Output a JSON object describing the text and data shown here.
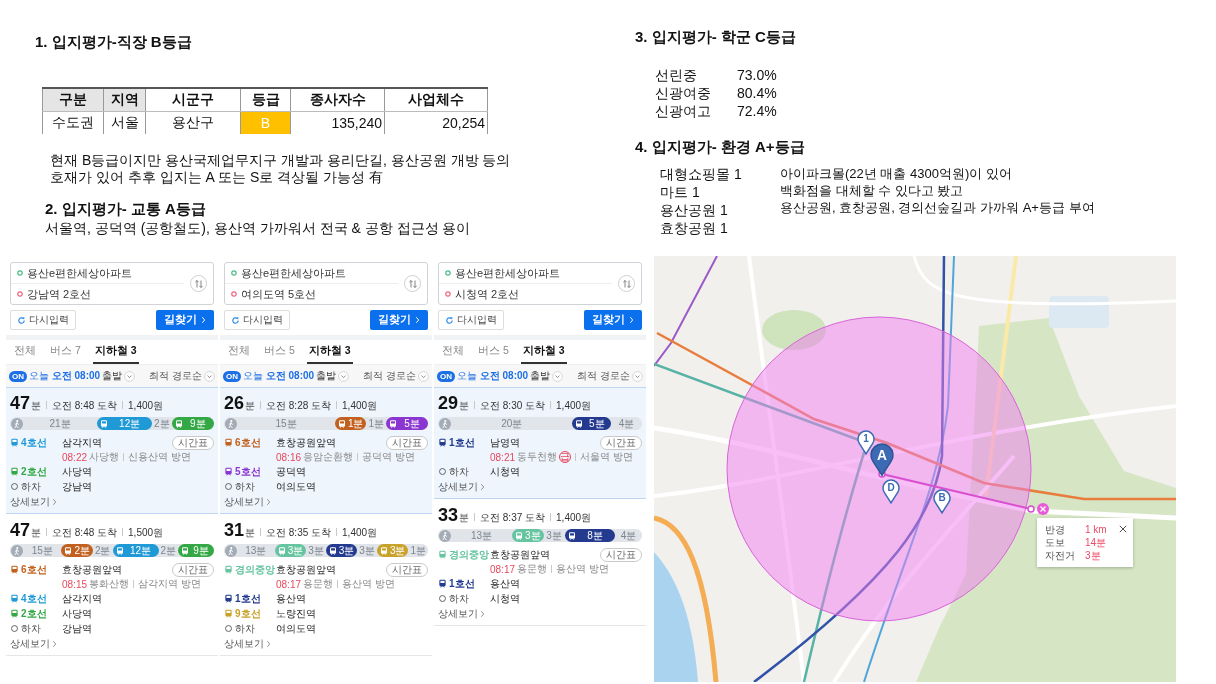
{
  "section1": {
    "heading": "1. 입지평가-직장 B등급",
    "table": {
      "columns": [
        {
          "label": "구분",
          "shaded": true
        },
        {
          "label": "지역",
          "shaded": true
        },
        {
          "label": "시군구",
          "shaded": false
        },
        {
          "label": "등급",
          "shaded": false
        },
        {
          "label": "종사자수",
          "shaded": false
        },
        {
          "label": "사업체수",
          "shaded": false
        }
      ],
      "rows": [
        {
          "cells": [
            {
              "text": "수도권",
              "kind": "text"
            },
            {
              "text": "서울",
              "kind": "text"
            },
            {
              "text": "용산구",
              "kind": "text"
            },
            {
              "text": "B",
              "kind": "grade",
              "color": "#ffc000"
            },
            {
              "text": "135,240",
              "kind": "number"
            },
            {
              "text": "20,254",
              "kind": "number"
            }
          ]
        }
      ]
    },
    "note": [
      "현재 B등급이지만 용산국제업무지구 개발과 용리단길, 용산공원 개방 등의",
      "호재가 있어 추후 입지는 A 또는 S로 격상될 가능성 有"
    ]
  },
  "section2": {
    "heading": "2. 입지평가- 교통 A등급",
    "text": "서울역, 공덕역 (공항철도), 용산역 가까워서 전국 & 공항 접근성 용이"
  },
  "route_panels": [
    {
      "origin": "용산e편한세상아파트",
      "destination": "강남역 2호선",
      "reset_button": "다시입력",
      "search_button": "길찾기",
      "tabs": [
        {
          "label": "전체",
          "selected": false
        },
        {
          "label": "버스 7",
          "selected": false
        },
        {
          "label": "지하철 3",
          "selected": true
        }
      ],
      "toggle": {
        "label": "ON",
        "on": true
      },
      "departure": "오늘 **오전 08:00**",
      "departure_suffix": "출발",
      "sort": "최적 경로순",
      "routes": [
        {
          "selected": true,
          "duration": "47",
          "unit": "분",
          "arrival": "오전 8:48 도착",
          "fare": "1,400원",
          "segments": [
            {
              "kind": "walk",
              "label": "21분"
            },
            {
              "kind": "ride",
              "label": "12분",
              "color": "#1f9ad6"
            },
            {
              "kind": "transfer",
              "label": "2분"
            },
            {
              "kind": "ride",
              "label": "9분",
              "color": "#33a845"
            }
          ],
          "steps": [
            {
              "kind": "board",
              "line": "4호선",
              "color": "#1f9ad6",
              "station": "삼각지역",
              "timetable": "시간표",
              "time": "08:22",
              "direction": "사당행",
              "towards": "신용산역 방면"
            },
            {
              "kind": "board",
              "line": "2호선",
              "color": "#33a845",
              "station": "사당역"
            },
            {
              "kind": "alight",
              "line": "하차",
              "station": "강남역"
            }
          ],
          "details": "상세보기"
        },
        {
          "selected": false,
          "duration": "47",
          "unit": "분",
          "arrival": "오전 8:48 도착",
          "fare": "1,500원",
          "segments": [
            {
              "kind": "walk",
              "label": "15분"
            },
            {
              "kind": "ride",
              "label": "2분",
              "color": "#c2611f"
            },
            {
              "kind": "transfer",
              "label": "2분"
            },
            {
              "kind": "ride",
              "label": "12분",
              "color": "#1f9ad6"
            },
            {
              "kind": "transfer",
              "label": "2분"
            },
            {
              "kind": "ride",
              "label": "9분",
              "color": "#33a845"
            }
          ],
          "steps": [
            {
              "kind": "board",
              "line": "6호선",
              "color": "#c2611f",
              "station": "효창공원앞역",
              "timetable": "시간표",
              "time": "08:15",
              "direction": "봉화산행",
              "towards": "삼각지역 방면"
            },
            {
              "kind": "board",
              "line": "4호선",
              "color": "#1f9ad6",
              "station": "삼각지역"
            },
            {
              "kind": "board",
              "line": "2호선",
              "color": "#33a845",
              "station": "사당역"
            },
            {
              "kind": "alight",
              "line": "하차",
              "station": "강남역"
            }
          ],
          "details": "상세보기"
        }
      ]
    },
    {
      "origin": "용산e편한세상아파트",
      "destination": "여의도역 5호선",
      "reset_button": "다시입력",
      "search_button": "길찾기",
      "tabs": [
        {
          "label": "전체",
          "selected": false
        },
        {
          "label": "버스 5",
          "selected": false
        },
        {
          "label": "지하철 3",
          "selected": true
        }
      ],
      "toggle": {
        "label": "ON",
        "on": true
      },
      "departure": "오늘 **오전 08:00**",
      "departure_suffix": "출발",
      "sort": "최적 경로순",
      "routes": [
        {
          "selected": true,
          "duration": "26",
          "unit": "분",
          "arrival": "오전 8:28 도착",
          "fare": "1,400원",
          "segments": [
            {
              "kind": "walk",
              "label": "15분"
            },
            {
              "kind": "ride",
              "label": "1분",
              "color": "#c2611f"
            },
            {
              "kind": "transfer",
              "label": "1분"
            },
            {
              "kind": "ride",
              "label": "5분",
              "color": "#8b36d1"
            }
          ],
          "steps": [
            {
              "kind": "board",
              "line": "6호선",
              "color": "#c2611f",
              "station": "효창공원앞역",
              "timetable": "시간표",
              "time": "08:16",
              "direction": "응암순환행",
              "towards": "공덕역 방면"
            },
            {
              "kind": "board",
              "line": "5호선",
              "color": "#8b36d1",
              "station": "공덕역"
            },
            {
              "kind": "alight",
              "line": "하차",
              "station": "여의도역"
            }
          ],
          "details": "상세보기"
        },
        {
          "selected": false,
          "duration": "31",
          "unit": "분",
          "arrival": "오전 8:35 도착",
          "fare": "1,400원",
          "segments": [
            {
              "kind": "walk",
              "label": "13분"
            },
            {
              "kind": "ride",
              "label": "3분",
              "color": "#66c4a0"
            },
            {
              "kind": "transfer",
              "label": "3분"
            },
            {
              "kind": "ride",
              "label": "3분",
              "color": "#233a8f"
            },
            {
              "kind": "transfer",
              "label": "3분"
            },
            {
              "kind": "ride",
              "label": "3분",
              "color": "#c9a22a"
            },
            {
              "kind": "transfer",
              "label": "1분"
            }
          ],
          "steps": [
            {
              "kind": "board",
              "line": "경의중앙",
              "color": "#66c4a0",
              "station": "효창공원앞역",
              "timetable": "시간표",
              "time": "08:17",
              "direction": "용문행",
              "towards": "용산역 방면"
            },
            {
              "kind": "board",
              "line": "1호선",
              "color": "#233a8f",
              "station": "용산역"
            },
            {
              "kind": "board",
              "line": "9호선",
              "color": "#c9a22a",
              "station": "노량진역"
            },
            {
              "kind": "alight",
              "line": "하차",
              "station": "여의도역"
            }
          ],
          "details": "상세보기"
        }
      ]
    },
    {
      "origin": "용산e편한세상아파트",
      "destination": "시청역 2호선",
      "reset_button": "다시입력",
      "search_button": "길찾기",
      "tabs": [
        {
          "label": "전체",
          "selected": false
        },
        {
          "label": "버스 5",
          "selected": false
        },
        {
          "label": "지하철 3",
          "selected": true
        }
      ],
      "toggle": {
        "label": "ON",
        "on": true
      },
      "departure": "오늘 **오전 08:00**",
      "departure_suffix": "출발",
      "sort": "최적 경로순",
      "routes": [
        {
          "selected": true,
          "duration": "29",
          "unit": "분",
          "arrival": "오전 8:30 도착",
          "fare": "1,400원",
          "segments": [
            {
              "kind": "walk",
              "label": "20분"
            },
            {
              "kind": "ride",
              "label": "5분",
              "color": "#233a8f"
            },
            {
              "kind": "transfer",
              "label": "4분"
            }
          ],
          "steps": [
            {
              "kind": "board",
              "line": "1호선",
              "color": "#233a8f",
              "station": "남영역",
              "timetable": "시간표",
              "time": "08:21",
              "direction": "동두천행",
              "badge": "급",
              "towards": "서울역 방면"
            },
            {
              "kind": "alight",
              "line": "하차",
              "station": "시청역"
            }
          ],
          "details": "상세보기"
        },
        {
          "selected": false,
          "duration": "33",
          "unit": "분",
          "arrival": "오전 8:37 도착",
          "fare": "1,400원",
          "segments": [
            {
              "kind": "walk",
              "label": "13분"
            },
            {
              "kind": "ride",
              "label": "3분",
              "color": "#66c4a0"
            },
            {
              "kind": "transfer",
              "label": "3분"
            },
            {
              "kind": "ride",
              "label": "8분",
              "color": "#233a8f"
            },
            {
              "kind": "transfer",
              "label": "4분"
            }
          ],
          "steps": [
            {
              "kind": "board",
              "line": "경의중앙",
              "color": "#66c4a0",
              "station": "효창공원앞역",
              "timetable": "시간표",
              "time": "08:17",
              "direction": "용문행",
              "towards": "용산역 방면"
            },
            {
              "kind": "board",
              "line": "1호선",
              "color": "#233a8f",
              "station": "용산역"
            },
            {
              "kind": "alight",
              "line": "하차",
              "station": "시청역"
            }
          ],
          "details": "상세보기"
        }
      ]
    }
  ],
  "section3": {
    "heading": "3. 입지평가- 학군 C등급",
    "schools": [
      {
        "name": "선린중",
        "value": "73.0%"
      },
      {
        "name": "신광여중",
        "value": "80.4%"
      },
      {
        "name": "신광여고",
        "value": "72.4%"
      }
    ]
  },
  "section4": {
    "heading": "4. 입지평가- 환경 A+등급",
    "facilities": [
      "대형쇼핑몰 1",
      "마트 1",
      "용산공원 1",
      "효창공원 1"
    ],
    "note": [
      "아이파크몰(22년 매출 4300억원)이 있어",
      "백화점을 대체할 수 있다고 봤고",
      "용산공원, 효창공원, 경의선숲길과 가까워 A+등급 부여"
    ]
  },
  "map": {
    "markers": [
      {
        "label": "1",
        "kind": "outline"
      },
      {
        "label": "A",
        "kind": "filled"
      },
      {
        "label": "D",
        "kind": "outline"
      },
      {
        "label": "B",
        "kind": "outline"
      }
    ],
    "measure_popup": {
      "rows": [
        {
          "label": "반경",
          "value": "1 km"
        },
        {
          "label": "도보",
          "value": "14분"
        },
        {
          "label": "자전거",
          "value": "3분"
        }
      ]
    }
  }
}
